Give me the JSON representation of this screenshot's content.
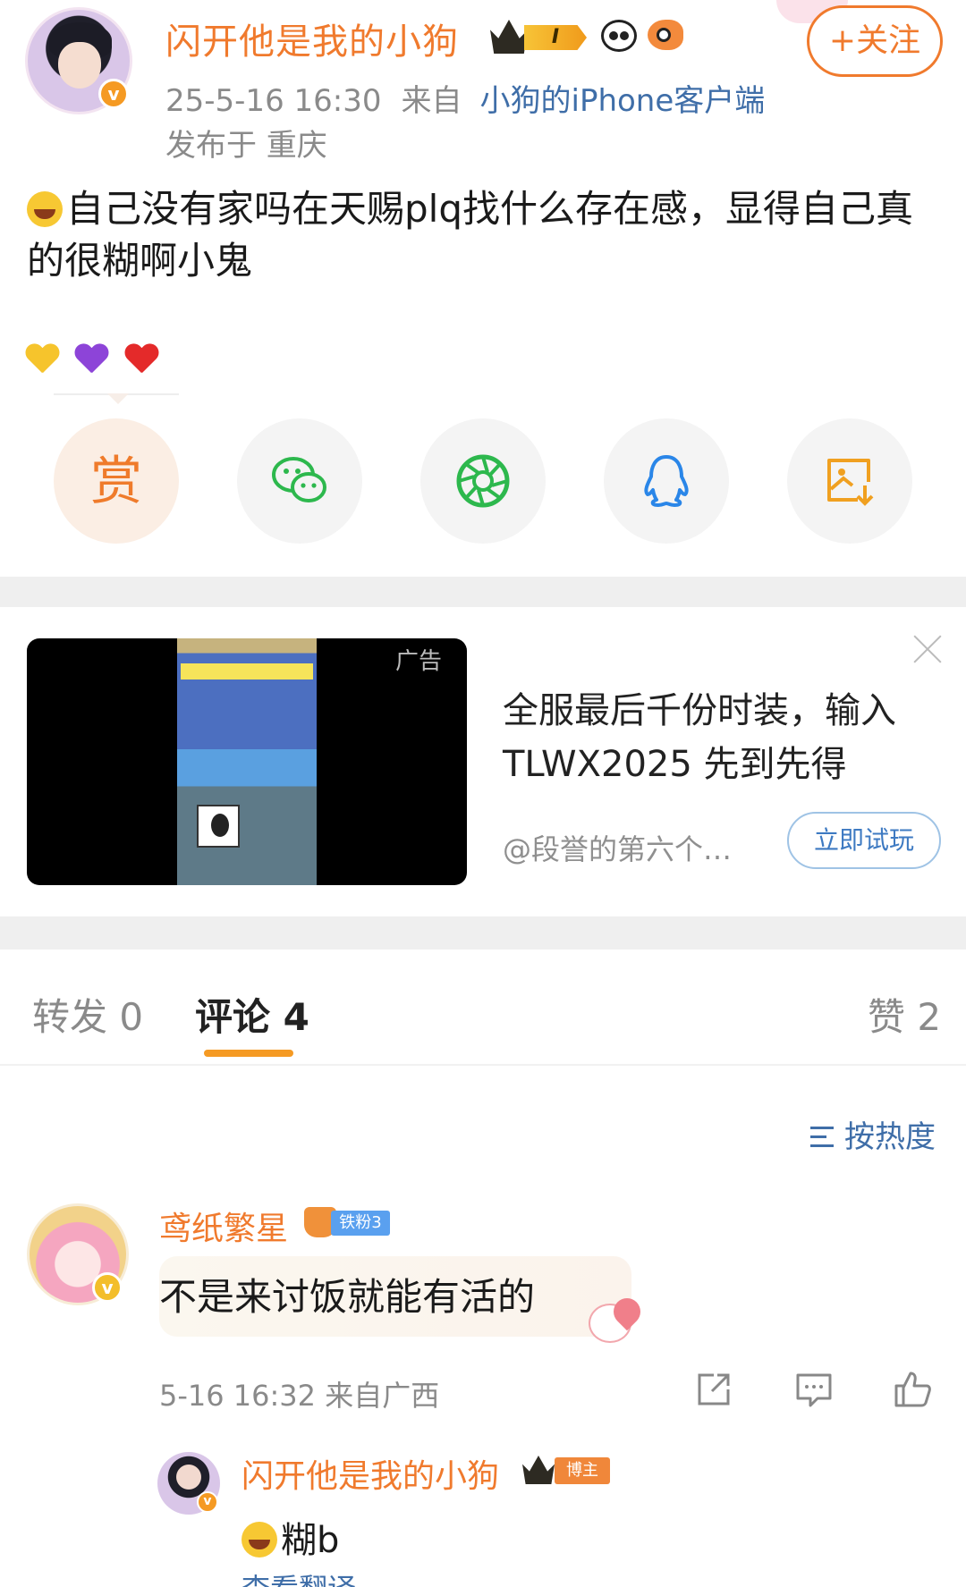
{
  "post": {
    "username": "闪开他是我的小狗",
    "level_badge": "I",
    "follow_label": "+关注",
    "timestamp": "25-5-16 16:30",
    "from_label": "来自",
    "source": "小狗的iPhone客户端",
    "location": "发布于 重庆",
    "text": "自己没有家吗在天赐plq找什么存在感，显得自己真的很糊啊小鬼",
    "emoji_hearts": [
      "yellow-heart",
      "purple-heart",
      "red-heart"
    ],
    "reward_label": "赏",
    "share_icons": [
      "wechat-icon",
      "moments-icon",
      "qq-icon",
      "save-image-icon"
    ]
  },
  "ad": {
    "label": "广告",
    "title": "全服最后千份时装，输入TLWX2025 先到先得",
    "advertiser": "@段誉的第六个…",
    "cta": "立即试玩"
  },
  "tabs": {
    "repost": "转发 0",
    "comments": "评论 4",
    "likes": "赞 2"
  },
  "sort": {
    "label": "按热度"
  },
  "comment": {
    "username": "鸢纸繁星",
    "fan_badge": "铁粉3",
    "text": "不是来讨饭就能有活的",
    "meta": "5-16 16:32 来自广西"
  },
  "reply": {
    "username": "闪开他是我的小狗",
    "badge": "博主",
    "text": "糊b",
    "translate": "查看翻译"
  },
  "colors": {
    "accent_orange": "#f07a2d",
    "link_blue": "#3f6ea8",
    "wechat_green": "#2db84d",
    "qq_blue": "#2a86e8",
    "tab_underline": "#f59a23"
  }
}
